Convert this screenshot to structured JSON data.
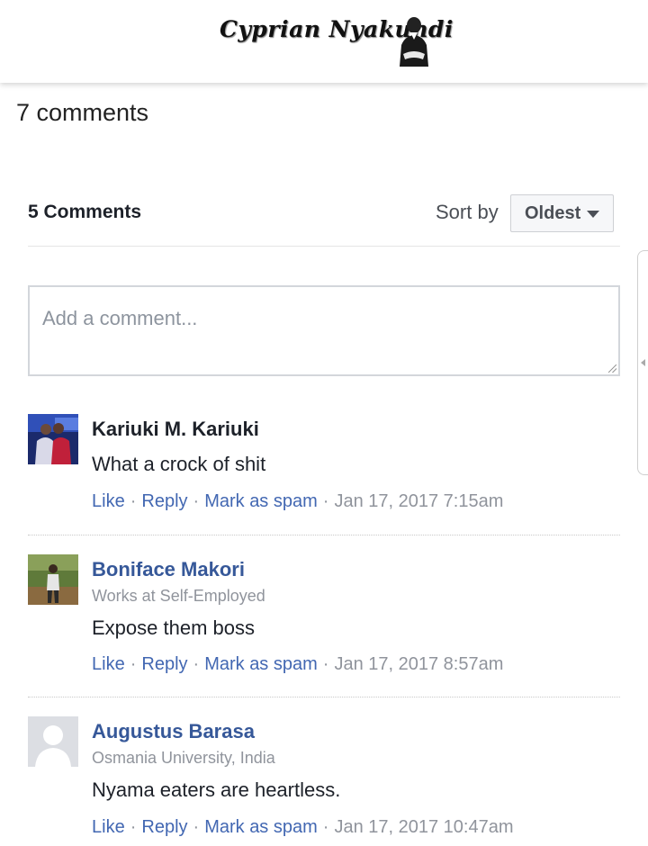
{
  "site": {
    "logo_text": "Cyprian Nyakundi"
  },
  "page": {
    "comments_count": "7 comments"
  },
  "plugin": {
    "count_title": "5 Comments",
    "sort_label": "Sort by",
    "sort_value": "Oldest",
    "comment_placeholder": "Add a comment..."
  },
  "comments": [
    {
      "name": "Kariuki M. Kariuki",
      "subtitle": "",
      "text": "What a crock of shit",
      "like": "Like",
      "reply": "Reply",
      "spam": "Mark as spam",
      "time": "Jan 17, 2017 7:15am",
      "avatar": "photo-two-people-blue"
    },
    {
      "name": "Boniface Makori",
      "subtitle": "Works at Self-Employed",
      "text": "Expose them boss",
      "like": "Like",
      "reply": "Reply",
      "spam": "Mark as spam",
      "time": "Jan 17, 2017 8:57am",
      "avatar": "photo-man-outdoors"
    },
    {
      "name": "Augustus Barasa",
      "subtitle": "Osmania University, India",
      "text": "Nyama eaters are heartless.",
      "like": "Like",
      "reply": "Reply",
      "spam": "Mark as spam",
      "time": "Jan 17, 2017 10:47am",
      "avatar": "default-silhouette"
    }
  ],
  "colors": {
    "link": "#4267b2",
    "name_link": "#365899",
    "meta": "#90949c"
  }
}
